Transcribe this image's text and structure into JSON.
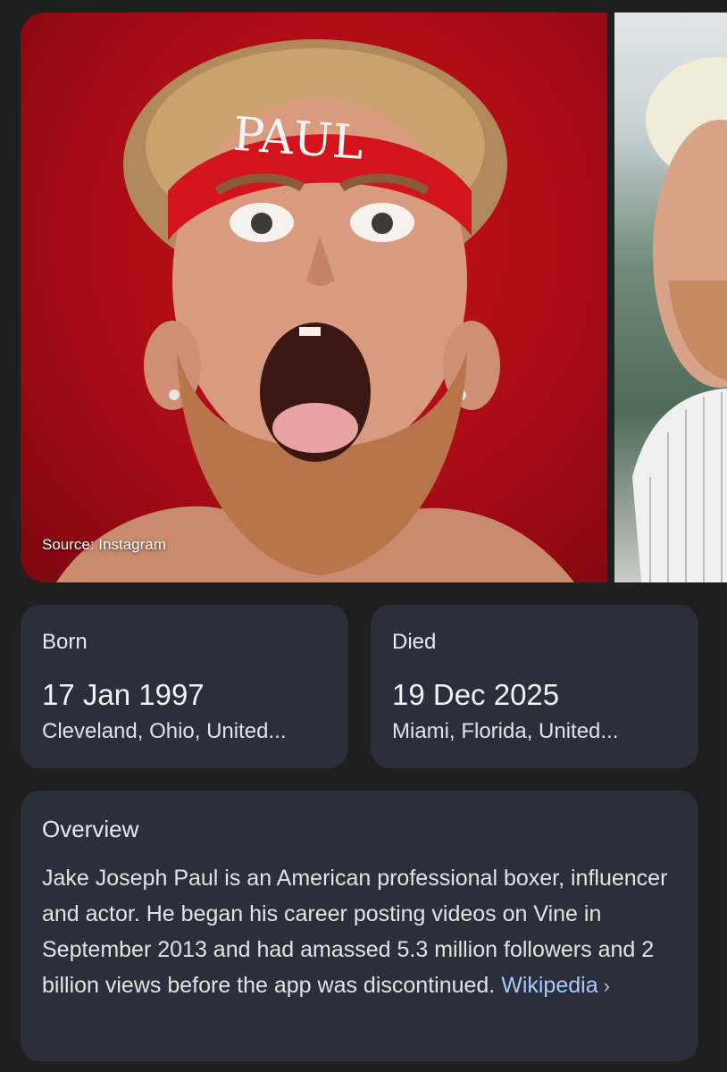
{
  "gallery": {
    "source_label": "Source: Instagram",
    "headband_text": "PAUL"
  },
  "born": {
    "label": "Born",
    "date": "17 Jan 1997",
    "place": "Cleveland, Ohio, United..."
  },
  "died": {
    "label": "Died",
    "date": "19 Dec 2025",
    "place": "Miami, Florida, United..."
  },
  "overview": {
    "title": "Overview",
    "text": "Jake Joseph Paul is an American professional boxer, influencer and actor. He began his career posting videos on Vine in September 2013 and had amassed 5.3 million followers and 2 billion views before the app was discontinued.",
    "link_label": "Wikipedia",
    "chevron_icon": "chevron-right-icon",
    "link_color": "#a8c7fa"
  },
  "colors": {
    "background": "#1f1f1f",
    "card": "#2b2f3a",
    "photo_red": "#b30e18"
  }
}
